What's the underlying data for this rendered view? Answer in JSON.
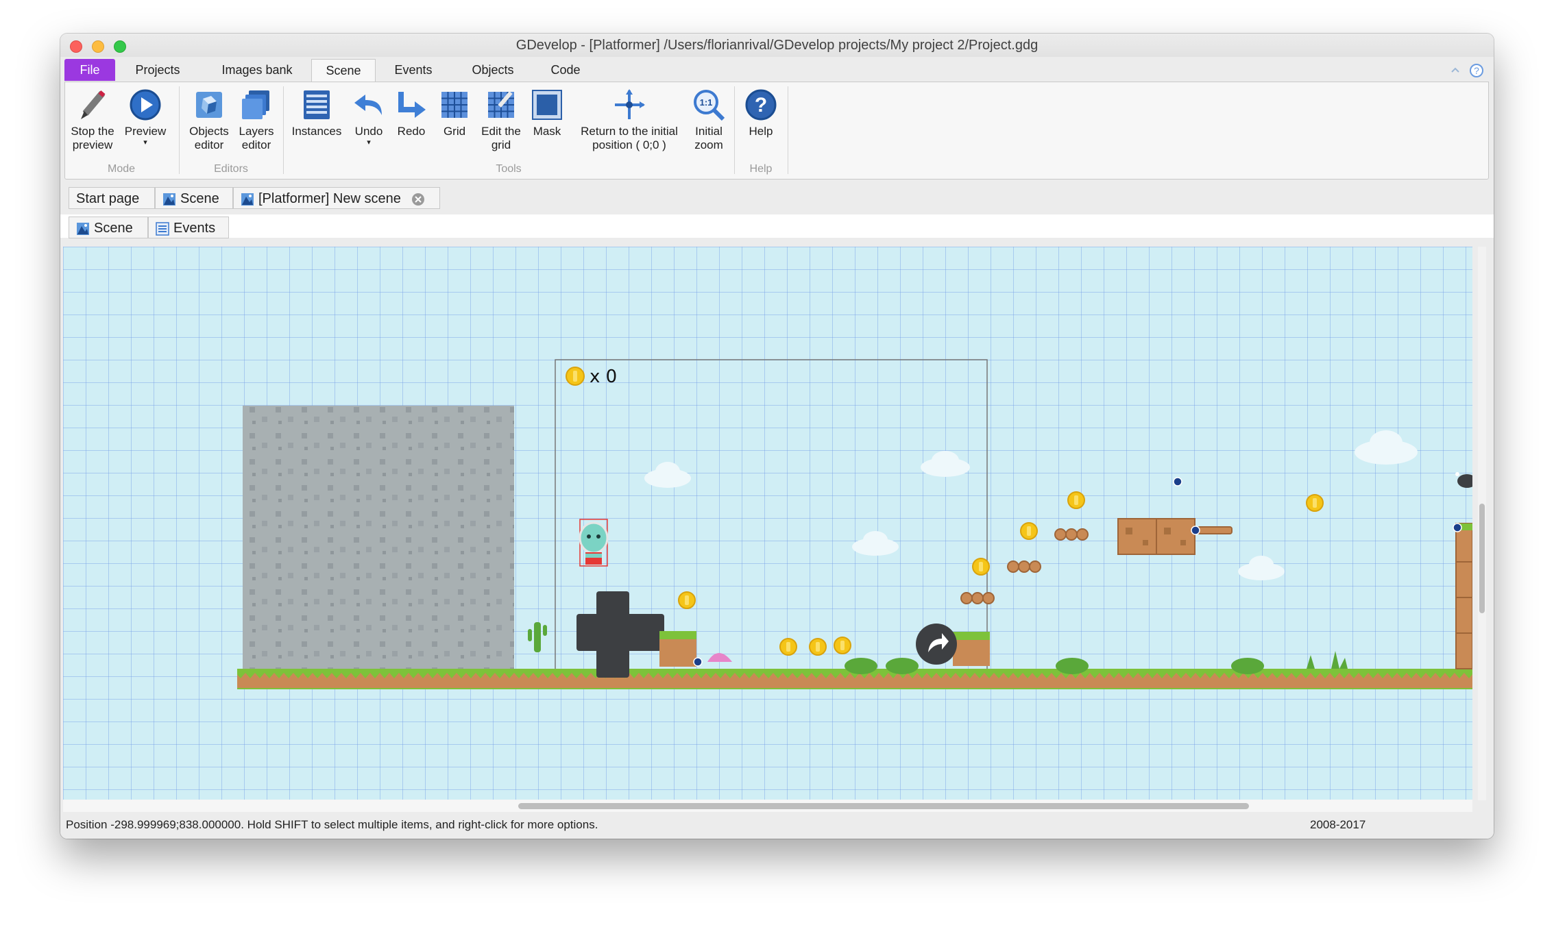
{
  "window": {
    "title": "GDevelop - [Platformer] /Users/florianrival/GDevelop projects/My project 2/Project.gdg"
  },
  "menu_tabs": {
    "items": [
      "File",
      "Projects",
      "Images bank",
      "Scene",
      "Events",
      "Objects",
      "Code"
    ],
    "active": "Scene"
  },
  "ribbon": {
    "buttons": [
      {
        "label": "Stop the preview",
        "icon": "pencil-icon",
        "group": "Mode"
      },
      {
        "label": "Preview",
        "icon": "play-icon",
        "group": "Mode",
        "dropdown": true
      },
      {
        "label": "Objects editor",
        "icon": "objects-editor-icon",
        "group": "Editors"
      },
      {
        "label": "Layers editor",
        "icon": "layers-icon",
        "group": "Editors"
      },
      {
        "label": "Instances",
        "icon": "instances-list-icon",
        "group": "Tools"
      },
      {
        "label": "Undo",
        "icon": "undo-icon",
        "group": "Tools",
        "dropdown": true
      },
      {
        "label": "Redo",
        "icon": "redo-icon",
        "group": "Tools"
      },
      {
        "label": "Grid",
        "icon": "grid-icon",
        "group": "Tools"
      },
      {
        "label": "Edit the grid",
        "icon": "edit-grid-icon",
        "group": "Tools"
      },
      {
        "label": "Mask",
        "icon": "mask-icon",
        "group": "Tools"
      },
      {
        "label": "Return to the initial position ( 0;0 )",
        "icon": "crosshair-icon",
        "group": "Tools"
      },
      {
        "label": "Initial zoom",
        "icon": "zoom-1to1-icon",
        "group": "Tools",
        "dropdown": true
      },
      {
        "label": "Help",
        "icon": "help-icon",
        "group": "Help"
      }
    ],
    "groups": [
      "Mode",
      "Editors",
      "Tools",
      "Help"
    ]
  },
  "doc_tabs": {
    "items": [
      "Start page",
      "Scene",
      "[Platformer] New scene"
    ]
  },
  "sub_tabs": {
    "items": [
      "Scene",
      "Events"
    ]
  },
  "scene": {
    "score_text": "x 0",
    "background_color": "#d0eef5",
    "grid_color": "#769ee6"
  },
  "status": {
    "text": "Position -298.999969;838.000000. Hold SHIFT to select multiple items, and right-click for more options.",
    "year": "2008-2017"
  },
  "colors": {
    "file_tab": "#9b38e0",
    "ground_grass": "#7dc23a",
    "ground_dirt": "#c98a55",
    "coin": "#f5c518",
    "stone": "#a8b0b2"
  }
}
